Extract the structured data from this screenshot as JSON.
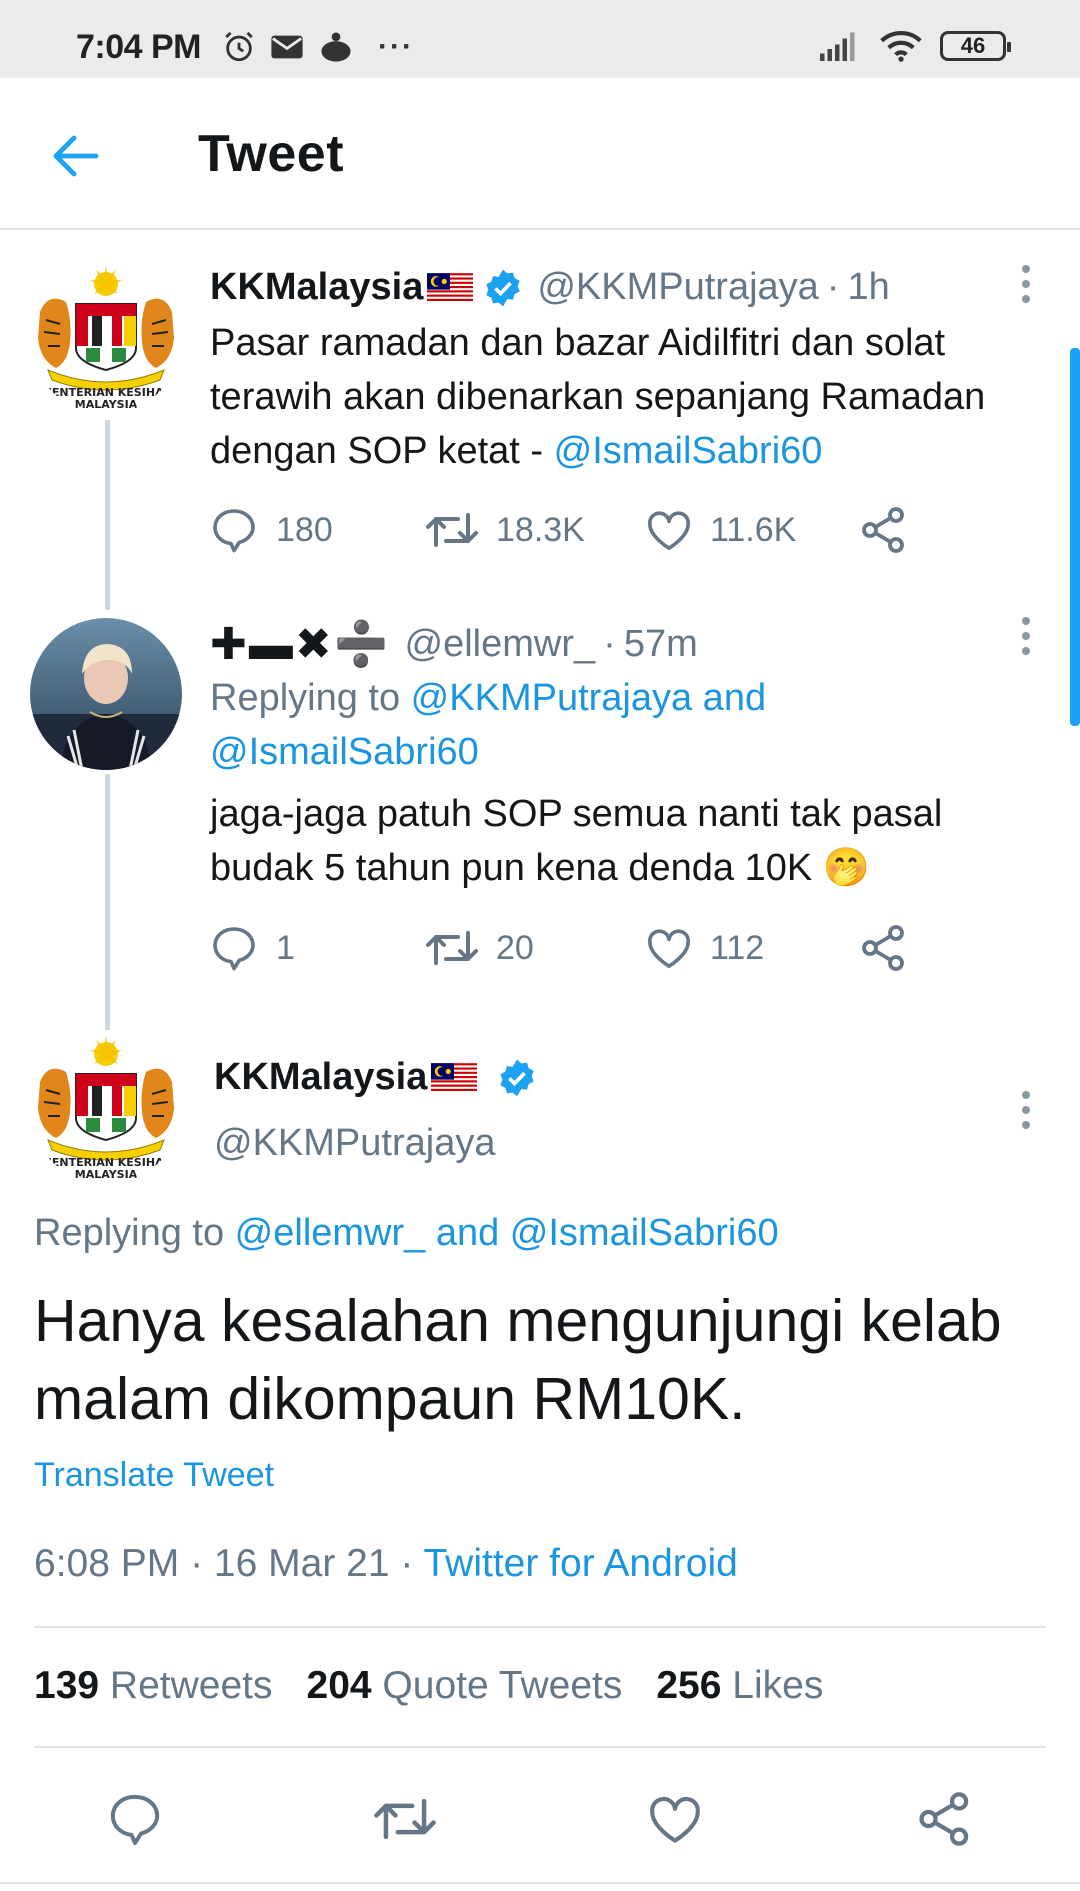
{
  "status_bar": {
    "time": "7:04 PM",
    "icons": [
      "alarm-icon",
      "mail-icon",
      "app-icon",
      "more-notifications-icon"
    ],
    "right_icons": [
      "signal-icon",
      "wifi-icon"
    ],
    "battery": "46"
  },
  "header": {
    "title": "Tweet",
    "back_icon": "arrow-left-icon"
  },
  "thread": [
    {
      "name": "KKMalaysia",
      "handle": "@KKMPutrajaya",
      "sep": "·",
      "time": "1h",
      "text_plain": "Pasar ramadan dan bazar Aidilfitri dan solat terawih akan dibenarkan sepanjang Ramadan dengan SOP ketat - ",
      "text_mention": "@IsmailSabri60",
      "reply_count": "180",
      "retweet_count": "18.3K",
      "like_count": "11.6K"
    },
    {
      "name": "✚▬✖➗",
      "handle": "@ellemwr_",
      "sep": "·",
      "time": "57m",
      "replying_prefix": "Replying to ",
      "replying_to_1": "@KKMPutrajaya and",
      "replying_to_2": "@IsmailSabri60",
      "text": "jaga-jaga patuh SOP semua nanti tak pasal budak 5 tahun pun kena denda 10K 🤭",
      "reply_count": "1",
      "retweet_count": "20",
      "like_count": "112"
    }
  ],
  "main_tweet": {
    "name": "KKMalaysia",
    "handle": "@KKMPutrajaya",
    "replying_prefix": "Replying to ",
    "replying_to": "@ellemwr_ and @IsmailSabri60",
    "text": "Hanya kesalahan mengunjungi kelab malam dikompaun RM10K.",
    "translate": "Translate Tweet",
    "time": "6:08 PM",
    "date": "16 Mar 21",
    "sep1": " · ",
    "sep2": " · ",
    "source": "Twitter for Android",
    "retweets_count": "139",
    "retweets_label": "Retweets",
    "quotes_count": "204",
    "quotes_label": "Quote Tweets",
    "likes_count": "256",
    "likes_label": "Likes"
  },
  "colors": {
    "accent": "#1da1f2",
    "link": "#1b95e0",
    "muted": "#657786",
    "text": "#14171a",
    "thread_line": "#ccd6dd"
  }
}
